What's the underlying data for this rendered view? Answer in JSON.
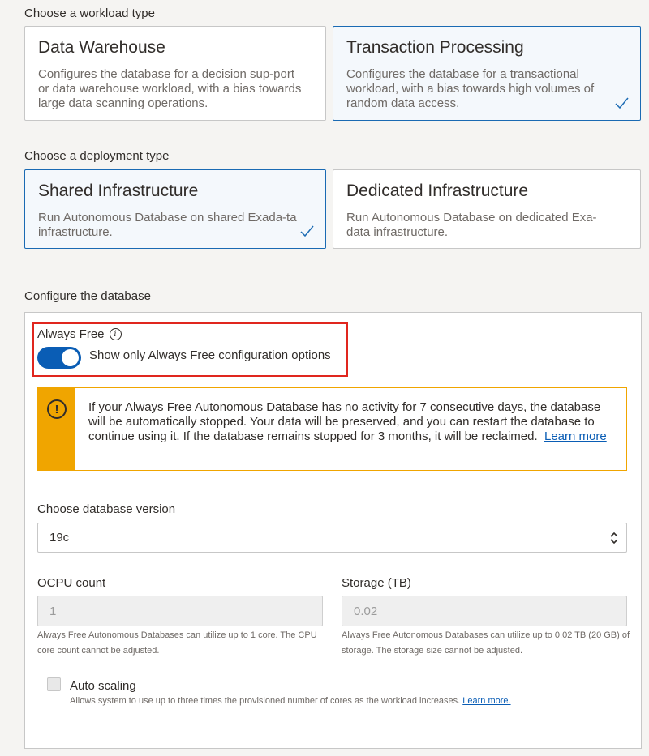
{
  "workload": {
    "label": "Choose a workload type",
    "options": [
      {
        "title": "Data Warehouse",
        "desc": "Configures the database for a decision sup-port or data warehouse workload, with a bias towards large data scanning operations.",
        "selected": false
      },
      {
        "title": "Transaction Processing",
        "desc": "Configures the database for a transactional workload, with a bias towards high volumes of random data access.",
        "selected": true
      }
    ]
  },
  "deployment": {
    "label": "Choose a deployment type",
    "options": [
      {
        "title": "Shared Infrastructure",
        "desc": "Run Autonomous Database on shared Exada-ta infrastructure.",
        "selected": true
      },
      {
        "title": "Dedicated Infrastructure",
        "desc": "Run Autonomous Database on dedicated Exa-data infrastructure.",
        "selected": false
      }
    ]
  },
  "config": {
    "label": "Configure the database",
    "always_free": {
      "label": "Always Free",
      "info_icon": "info-icon",
      "toggle_text": "Show only Always Free configuration options",
      "enabled": true
    },
    "warning": {
      "icon": "exclamation-icon",
      "text": "If your Always Free Autonomous Database has no activity for 7 consecutive days, the database will be automatically stopped. Your data will be preserved, and you can restart the database to continue using it. If the database remains stopped for 3 months, it will be reclaimed.",
      "link": "Learn more"
    },
    "version": {
      "label": "Choose database version",
      "value": "19c"
    },
    "ocpu": {
      "label": "OCPU count",
      "value": "1",
      "help": "Always Free Autonomous Databases can utilize up to 1 core. The CPU core count cannot be adjusted."
    },
    "storage": {
      "label": "Storage (TB)",
      "value": "0.02",
      "help": "Always Free Autonomous Databases can utilize up to 0.02 TB (20 GB) of storage. The storage size cannot be adjusted."
    },
    "auto_scaling": {
      "label": "Auto scaling",
      "help": "Allows system to use up to three times the provisioned number of cores as the workload increases.",
      "link": "Learn more."
    }
  },
  "colors": {
    "accent": "#0a5db5",
    "warning": "#f0a500",
    "highlight": "#e0261e"
  }
}
